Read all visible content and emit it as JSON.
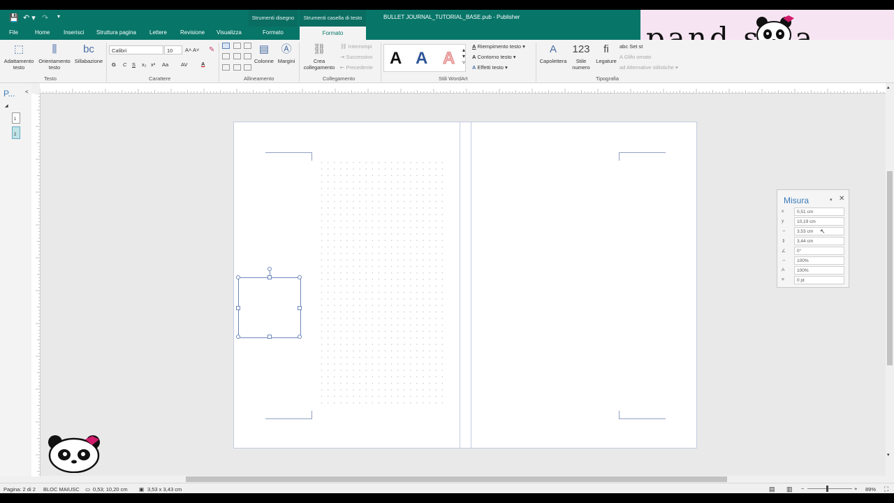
{
  "titlebar": {
    "ctx_tab_1": "Strumenti disegno",
    "ctx_tab_2": "Strumenti casella di testo",
    "doc_title": "BULLET JOURNAL_TUTORIAL_BASE.pub - Publisher",
    "qa_save": "💾",
    "qa_undo": "↶ ▾",
    "qa_redo": "↷",
    "qa_more": "▾"
  },
  "tabs": [
    "File",
    "Home",
    "Inserisci",
    "Struttura pagina",
    "Lettere",
    "Revisione",
    "Visualizza",
    "Formato",
    "Formato"
  ],
  "ribbon": {
    "testo": {
      "label": "Testo",
      "b1": "Adattamento testo",
      "b2": "Orientamento testo",
      "b3": "Sillabazione"
    },
    "carattere": {
      "label": "Carattere",
      "font": "Calibri",
      "size": "10",
      "bold": "G",
      "italic": "C",
      "underline": "S",
      "sub": "x₂",
      "sup": "x²",
      "case": "Aa",
      "spacing": "AV",
      "color": "A"
    },
    "allineamento": {
      "label": "Allineamento",
      "colonne": "Colonne",
      "margini": "Margini"
    },
    "collegamento": {
      "label": "Collegamento",
      "crea": "Crea collegamento",
      "interrompi": "Interrompi",
      "successivo": "Successivo",
      "precedente": "Precedente"
    },
    "wordart": {
      "label": "Stili WordArt",
      "riempimento": "Riempimento testo",
      "contorno": "Contorno testo",
      "effetti": "Effetti testo",
      "sample": "A"
    },
    "tipografia": {
      "label": "Tipografia",
      "capolettera": "Capolettera",
      "stile_numero": "Stile numero",
      "legature": "Legature",
      "set_stilistico": "Set st",
      "glifo": "Glifo ornato",
      "alternative": "Alternative stilistiche"
    }
  },
  "brand": {
    "text": "pand sina"
  },
  "nav": {
    "title": "P...",
    "page1": "1",
    "page2": "2"
  },
  "misura": {
    "title": "Misura",
    "rows": [
      {
        "icon": "x",
        "value": "0,51 cm"
      },
      {
        "icon": "y",
        "value": "10,19 cm"
      },
      {
        "icon": "⇔",
        "value": "3,53 cm"
      },
      {
        "icon": "⇕",
        "value": "3,44 cm"
      },
      {
        "icon": "∠",
        "value": "0°"
      },
      {
        "icon": "↔",
        "value": "100%"
      },
      {
        "icon": "A",
        "value": "100%"
      },
      {
        "icon": "≡",
        "value": "0 pt"
      }
    ]
  },
  "status": {
    "page": "Pagina: 2 di 2",
    "caps": "BLOC MAIUSC",
    "position": "0,53; 10,20 cm",
    "size": "3,53 x 3,43 cm",
    "zoom": "89%"
  }
}
